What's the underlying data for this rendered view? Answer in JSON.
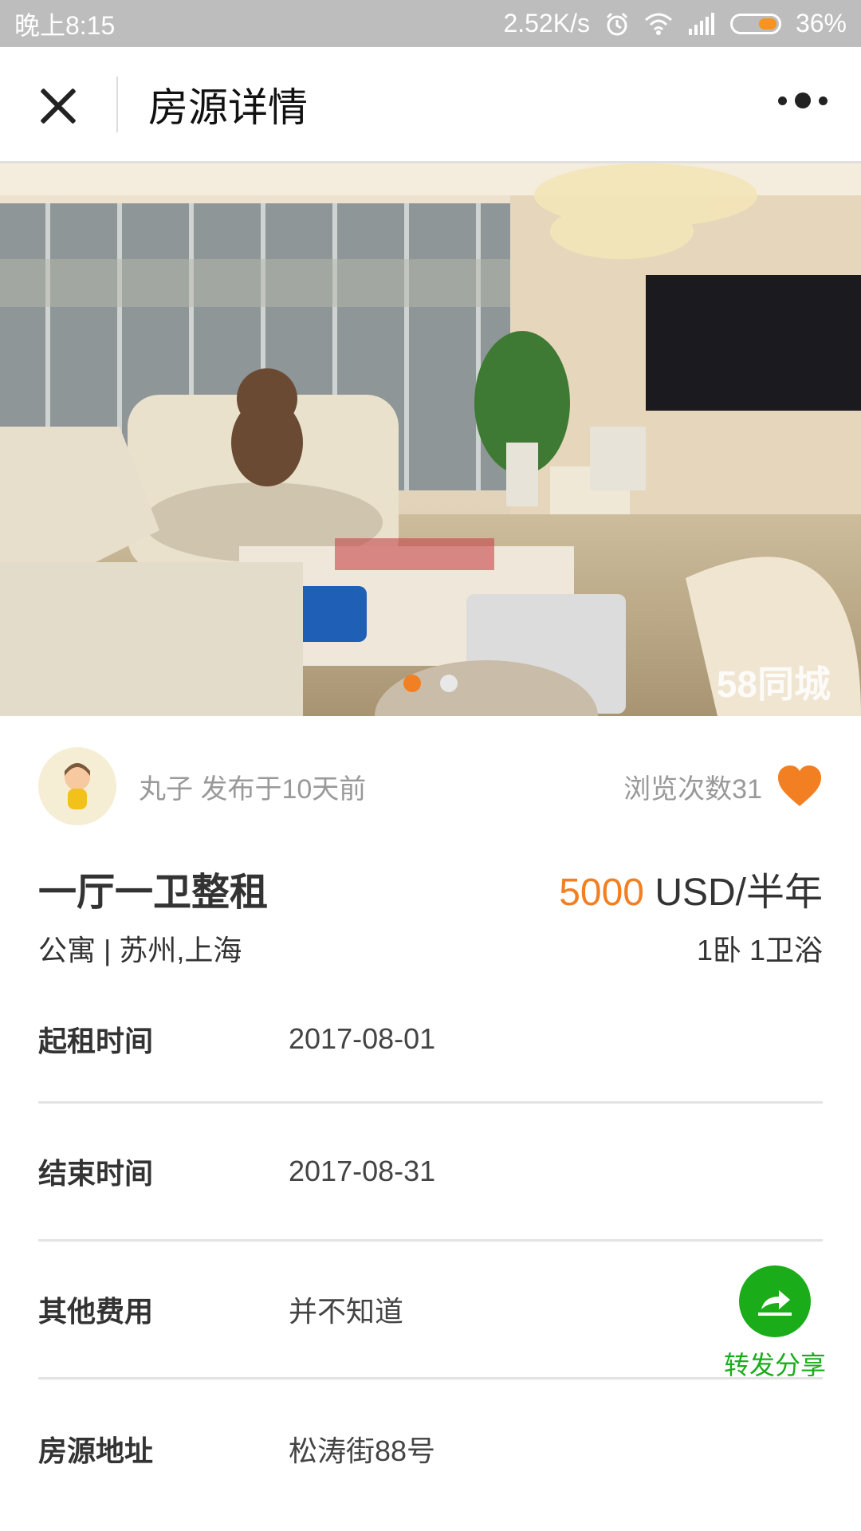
{
  "status_bar": {
    "time": "晚上8:15",
    "network_speed": "2.52K/s",
    "battery": "36%",
    "icons": [
      "alarm-icon",
      "wifi-icon",
      "signal-icon",
      "battery-icon"
    ]
  },
  "header": {
    "title": "房源详情",
    "close_icon": "close-icon",
    "more_icon": "more-icon"
  },
  "gallery": {
    "watermark": "58同城",
    "image_count": 2,
    "active_index": 0
  },
  "publisher": {
    "name": "丸子",
    "published": "发布于10天前",
    "views": "浏览次数31",
    "favorite_icon": "heart-icon"
  },
  "listing": {
    "title": "一厅一卫整租",
    "price": "5000",
    "price_unit": "USD/半年",
    "type_location": "公寓 | 苏州,上海",
    "rooms": "1卧 1卫浴"
  },
  "details": [
    {
      "label": "起租时间",
      "value": "2017-08-01"
    },
    {
      "label": "结束时间",
      "value": "2017-08-31"
    },
    {
      "label": "其他费用",
      "value": "并不知道"
    },
    {
      "label": "房源地址",
      "value": "松涛街88号"
    }
  ],
  "share": {
    "label": "转发分享",
    "icon": "share-icon"
  },
  "colors": {
    "accent": "#f28022",
    "share_green": "#1aad19",
    "status_bar": "#bdbdbd"
  }
}
